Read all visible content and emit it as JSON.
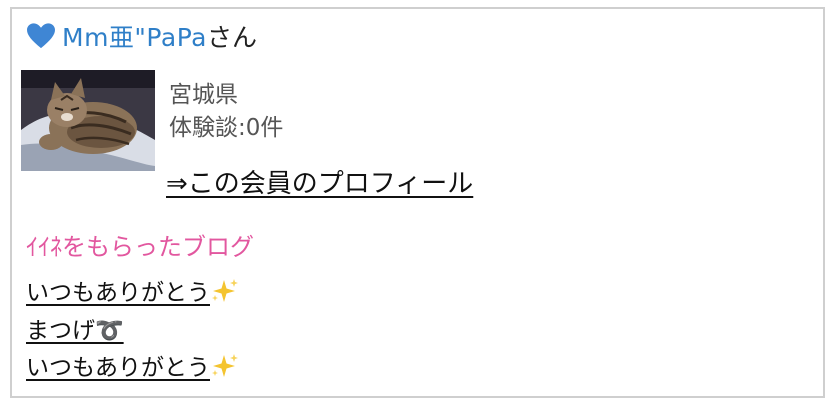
{
  "member": {
    "name": "Mm亜\"PaPa",
    "honorific": "さん",
    "prefecture": "宮城県",
    "stories_count": "体験談:0件",
    "profile_link": "⇒この会員のプロフィール",
    "heart_icon": "heart-icon",
    "name_color": "#2f7fc8"
  },
  "liked_blogs": {
    "title": "ｲｲﾈをもらったブログ",
    "title_color": "#e2579f",
    "items": [
      {
        "text": "いつもありがとう",
        "icon": "sparkles-icon"
      },
      {
        "text": "まつげ➰",
        "icon": ""
      },
      {
        "text": "いつもありがとう",
        "icon": "sparkles-icon"
      }
    ]
  }
}
